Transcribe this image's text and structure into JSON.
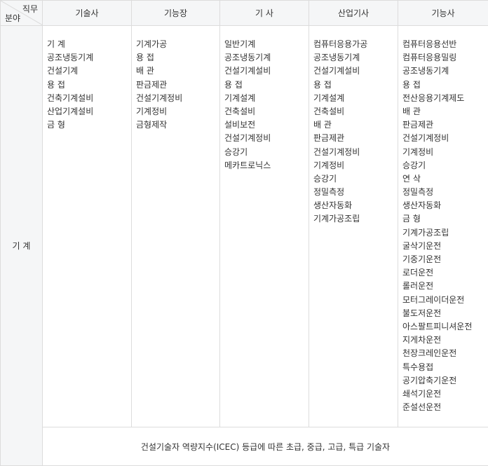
{
  "header": {
    "corner_top": "직무",
    "corner_bottom": "분야",
    "columns": [
      "기술사",
      "기능장",
      "기  사",
      "산업기사",
      "기능사"
    ]
  },
  "row_label": "기  계",
  "lists": [
    [
      "기  계",
      "공조냉동기계",
      "건설기계",
      "용  접",
      "건축기계설비",
      "산업기계설비",
      "금  형"
    ],
    [
      "기계가공",
      "용  접",
      "배  관",
      "판금제관",
      "건설기계정비",
      "기계정비",
      "금형제작"
    ],
    [
      "일반기계",
      "공조냉동기계",
      "건설기계설비",
      "용  접",
      "기계설계",
      "건축설비",
      "설비보전",
      "건설기계정비",
      "승강기",
      "메카트로닉스"
    ],
    [
      "컴퓨터응용가공",
      "공조냉동기계",
      "건설기계설비",
      "용  접",
      "기계설계",
      "건축설비",
      "배  관",
      "판금제관",
      "건설기계정비",
      "기계정비",
      "승강기",
      "정밀측정",
      "생산자동화",
      "기계가공조립"
    ],
    [
      "컴퓨터응용선반",
      "컴퓨터응용밀링",
      "공조냉동기계",
      "용  접",
      "전산응용기계제도",
      "배  관",
      "판금제관",
      "건설기계정비",
      "기계정비",
      "승강기",
      "연  삭",
      "정밀측정",
      "생산자동화",
      "금  형",
      "기계가공조립",
      "굴삭기운전",
      "기중기운전",
      "로더운전",
      "롤러운전",
      "모터그레이더운전",
      "불도저운전",
      "아스팔트피니셔운전",
      "지게차운전",
      "천장크레인운전",
      "특수용접",
      "공기압축기운전",
      "쇄석기운전",
      "준설선운전"
    ]
  ],
  "footer": "건설기술자 역량지수(ICEC) 등급에 따른 초급, 중급, 고급, 특급 기술자"
}
